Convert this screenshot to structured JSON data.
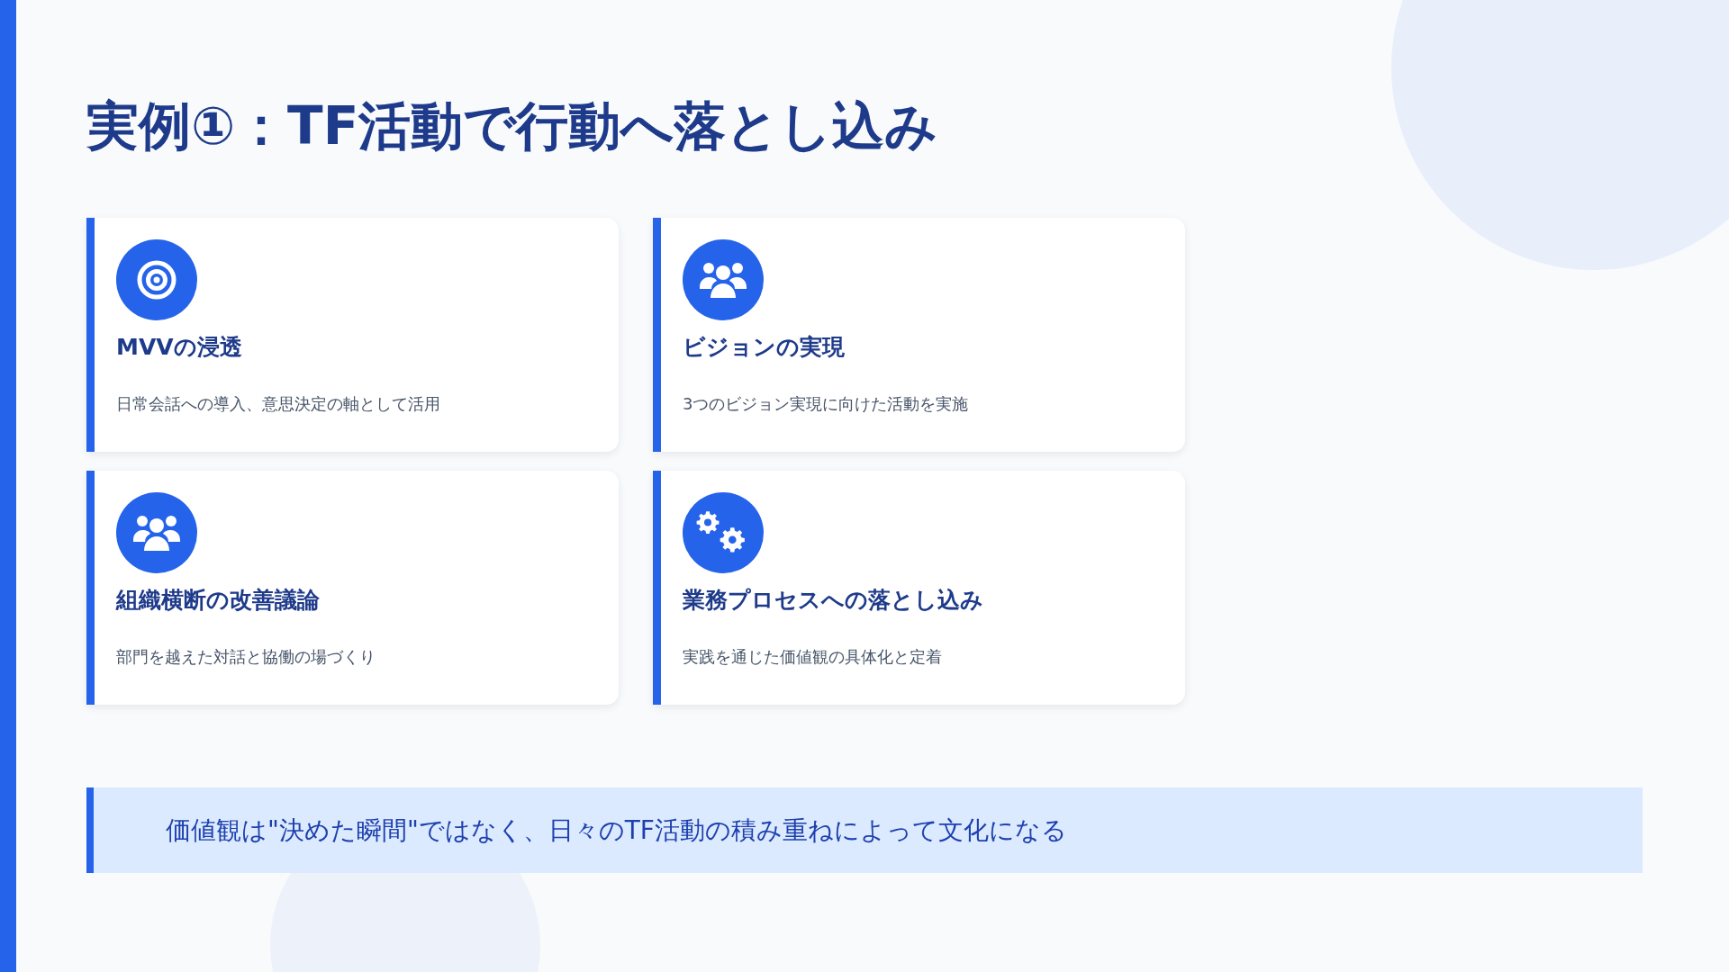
{
  "title": "実例①：TF活動で行動へ落とし込み",
  "cards": [
    {
      "kind": "target",
      "heading": "MVVの浸透",
      "text": "日常会話への導入、意思決定の軸として活用"
    },
    {
      "kind": "people",
      "heading": "ビジョンの実現",
      "text": "3つのビジョン実現に向けた活動を実施"
    },
    {
      "kind": "people",
      "heading": "組織横断の改善議論",
      "text": "部門を越えた対話と協働の場づくり"
    },
    {
      "kind": "gears",
      "heading": "業務プロセスへの落とし込み",
      "text": "実践を通じた価値観の具体化と定着"
    }
  ],
  "banner": "価値観は\"決めた瞬間\"ではなく、日々のTF活動の積み重ねによって文化になる"
}
